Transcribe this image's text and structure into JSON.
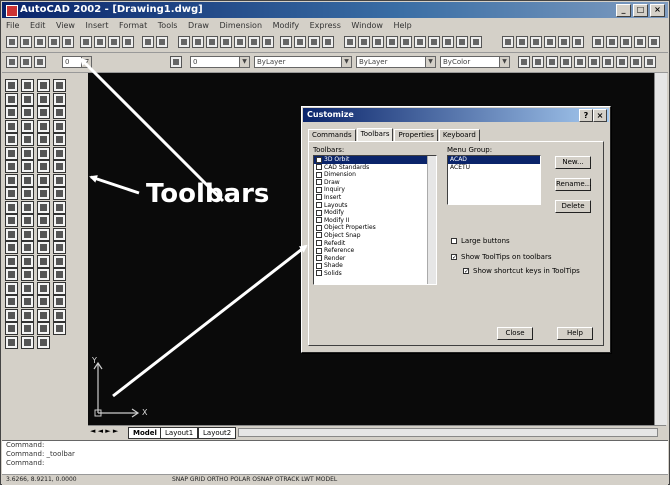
{
  "window": {
    "title": "AutoCAD 2002 - [Drawing1.dwg]",
    "controls": [
      "_",
      "□",
      "×"
    ]
  },
  "menubar": {
    "items": [
      "File",
      "Edit",
      "View",
      "Insert",
      "Format",
      "Tools",
      "Draw",
      "Dimension",
      "Modify",
      "Express",
      "Window",
      "Help"
    ]
  },
  "toolbars": {
    "layer_dropdown": "0",
    "linetype_dropdown": "ByLayer",
    "lineweight_dropdown": "ByLayer",
    "color_dropdown": "ByColor"
  },
  "annotation": {
    "text": "Toolbars"
  },
  "dialog": {
    "title": "Customize",
    "help_button": "?",
    "close_button": "×",
    "tabs": [
      "Commands",
      "Toolbars",
      "Properties",
      "Keyboard"
    ],
    "active_tab": 1,
    "toolbars_label": "Toolbars:",
    "menu_group_label": "Menu Group:",
    "toolbars_list": [
      {
        "label": "3D Orbit",
        "selected": true
      },
      {
        "label": "CAD Standards",
        "selected": false
      },
      {
        "label": "Dimension",
        "selected": false
      },
      {
        "label": "Draw",
        "selected": false
      },
      {
        "label": "Inquiry",
        "selected": false
      },
      {
        "label": "Insert",
        "selected": false
      },
      {
        "label": "Layouts",
        "selected": false
      },
      {
        "label": "Modify",
        "selected": false
      },
      {
        "label": "Modify II",
        "selected": false
      },
      {
        "label": "Object Properties",
        "selected": false
      },
      {
        "label": "Object Snap",
        "selected": false
      },
      {
        "label": "Refedit",
        "selected": false
      },
      {
        "label": "Reference",
        "selected": false
      },
      {
        "label": "Render",
        "selected": false
      },
      {
        "label": "Shade",
        "selected": false
      },
      {
        "label": "Solids",
        "selected": false
      }
    ],
    "menu_groups": [
      {
        "label": "ACAD",
        "selected": true
      },
      {
        "label": "ACETU",
        "selected": false
      }
    ],
    "buttons": {
      "new": "New...",
      "rename": "Rename...",
      "delete": "Delete",
      "close": "Close",
      "help": "Help"
    },
    "options": {
      "large_buttons": "Large buttons",
      "show_tooltips": "Show ToolTips on toolbars",
      "show_shortcut_keys": "Show shortcut keys in ToolTips"
    },
    "option_states": {
      "large_buttons": false,
      "show_tooltips": true,
      "show_shortcut_keys": true
    }
  },
  "layout_tabs": [
    "Model",
    "Layout1",
    "Layout2"
  ],
  "ucs": {
    "y": "Y",
    "x": "X"
  },
  "command_lines": [
    "Command:",
    "Command: _toolbar",
    "Command:"
  ],
  "status": {
    "coords": "3.6266, 8.9211, 0.0000",
    "modes": "SNAP GRID ORTHO POLAR OSNAP OTRACK LWT MODEL"
  }
}
